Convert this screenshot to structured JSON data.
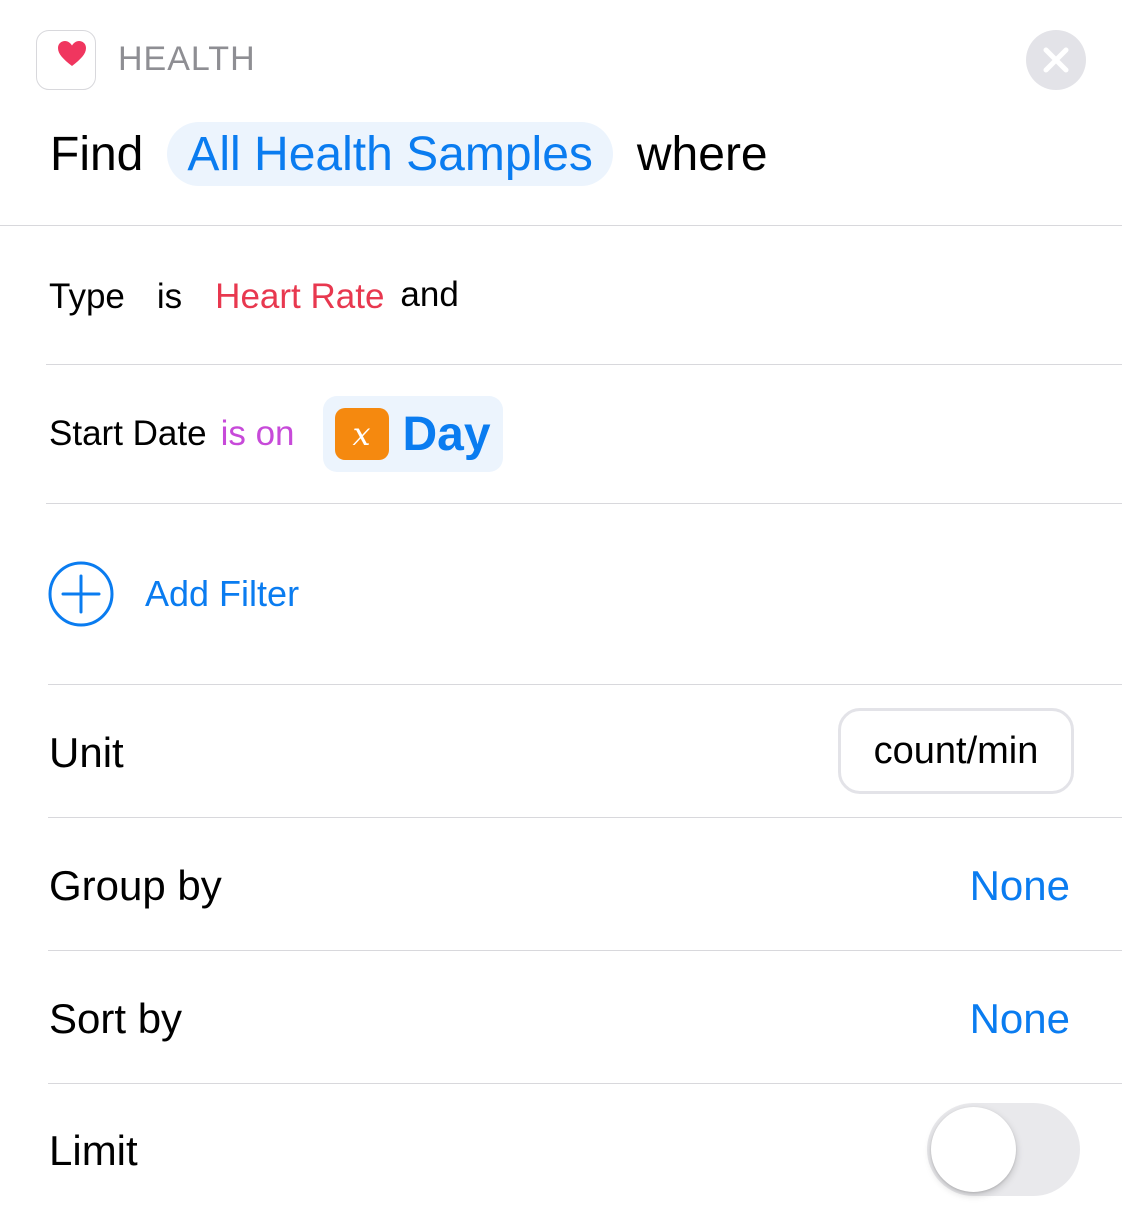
{
  "header": {
    "app_name": "HEALTH",
    "app_icon": "heart-icon",
    "close_icon": "close-icon"
  },
  "title": {
    "find": "Find",
    "target": "All Health Samples",
    "where": "where"
  },
  "filters": [
    {
      "field": "Type",
      "operator": "is",
      "value": "Heart Rate",
      "conjunction": "and"
    },
    {
      "field": "Start Date",
      "operator": "is on",
      "variable_icon": "x",
      "variable_name": "Day"
    }
  ],
  "add_filter": {
    "label": "Add Filter",
    "icon": "plus-circle-icon"
  },
  "settings": {
    "unit": {
      "label": "Unit",
      "value": "count/min"
    },
    "group_by": {
      "label": "Group by",
      "value": "None"
    },
    "sort_by": {
      "label": "Sort by",
      "value": "None"
    },
    "limit": {
      "label": "Limit",
      "enabled": false
    }
  },
  "colors": {
    "accent": "#0a7cf0",
    "heart": "#f0365f",
    "type_value": "#e8384f",
    "operator": "#c74ad9",
    "variable_badge": "#f5890f"
  }
}
